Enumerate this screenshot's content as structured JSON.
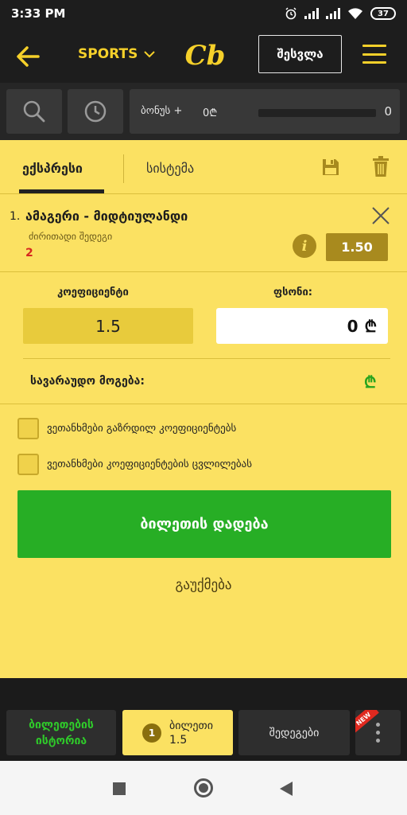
{
  "status_bar": {
    "time": "3:33 PM",
    "battery": "37"
  },
  "header": {
    "sports_label": "SPORTS",
    "logo_text": "Cb",
    "login_label": "შესვლა"
  },
  "search_row": {
    "bonus_label": "ბონუს +",
    "bonus_amount": "0₾",
    "bonus_count": "0"
  },
  "betslip": {
    "tabs": {
      "express": "ექსპრესი",
      "system": "სისტემა"
    },
    "event": {
      "index": "1.",
      "name": "ამაგერი - მიდტიულანდი",
      "market": "ძირითადი შედეგი",
      "pick": "2",
      "odds": "1.50"
    },
    "coef_label": "კოეფიციენტი",
    "coef_value": "1.5",
    "stake_label": "ფსონი:",
    "stake_value": "0",
    "currency": "₾",
    "win_label": "სავარაუდო მოგება:",
    "win_value": "₾",
    "checks": {
      "increased_odds": "ვეთანხმები გაზრდილ კოეფიციენტებს",
      "odds_change": "ვეთანხმები კოეფიციენტების ცვლილებას"
    },
    "place_bet_label": "ბილეთის დადება",
    "cancel_label": "გაუქმება"
  },
  "bottom_tabs": {
    "history_line1": "ბილეთების",
    "history_line2": "ისტორია",
    "ticket_count": "1",
    "ticket_label": "ბილეთი",
    "ticket_value": "1.5",
    "results_label": "შედეგები",
    "new_badge": "NEW"
  },
  "colors": {
    "accent": "#f5d02a",
    "panel": "#fbe162",
    "green": "#27ae25",
    "red": "#d6271f"
  }
}
